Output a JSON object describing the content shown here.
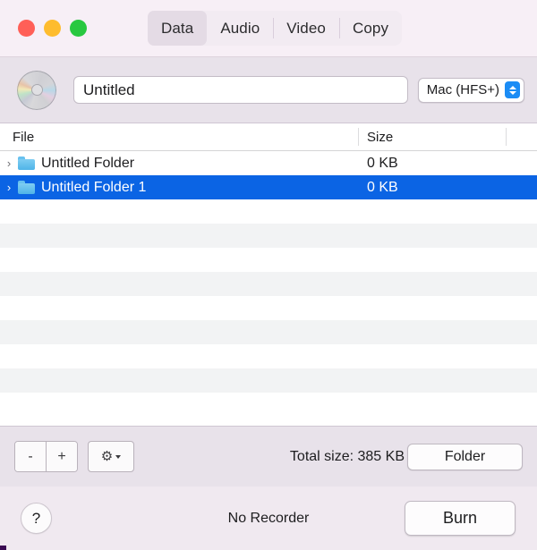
{
  "titlebar": {
    "traffic_lights": [
      {
        "name": "close",
        "color": "#ff5f57"
      },
      {
        "name": "minimize",
        "color": "#febc2e"
      },
      {
        "name": "maximize",
        "color": "#28c840"
      }
    ],
    "tabs": [
      {
        "label": "Data",
        "selected": true
      },
      {
        "label": "Audio",
        "selected": false
      },
      {
        "label": "Video",
        "selected": false
      },
      {
        "label": "Copy",
        "selected": false
      }
    ]
  },
  "toolbar": {
    "disc_icon": "disc-icon",
    "name_value": "Untitled",
    "name_placeholder": "Untitled",
    "format_value": "Mac (HFS+)"
  },
  "table": {
    "columns": [
      {
        "label": "File"
      },
      {
        "label": "Size"
      }
    ],
    "rows": [
      {
        "name": "Untitled Folder",
        "size": "0 KB",
        "selected": false,
        "expandable": true
      },
      {
        "name": "Untitled Folder 1",
        "size": "0 KB",
        "selected": true,
        "expandable": true
      }
    ],
    "empty_row_count": 9,
    "disclosure_glyph": "›",
    "selection_color": "#0b64e4"
  },
  "bottombar": {
    "remove_label": "-",
    "add_label": "+",
    "gear_label": "⚙",
    "total_size_label": "Total size: 385 KB",
    "folder_button_label": "Folder"
  },
  "footer": {
    "help_label": "?",
    "recorder_status": "No Recorder",
    "burn_button_label": "Burn"
  }
}
